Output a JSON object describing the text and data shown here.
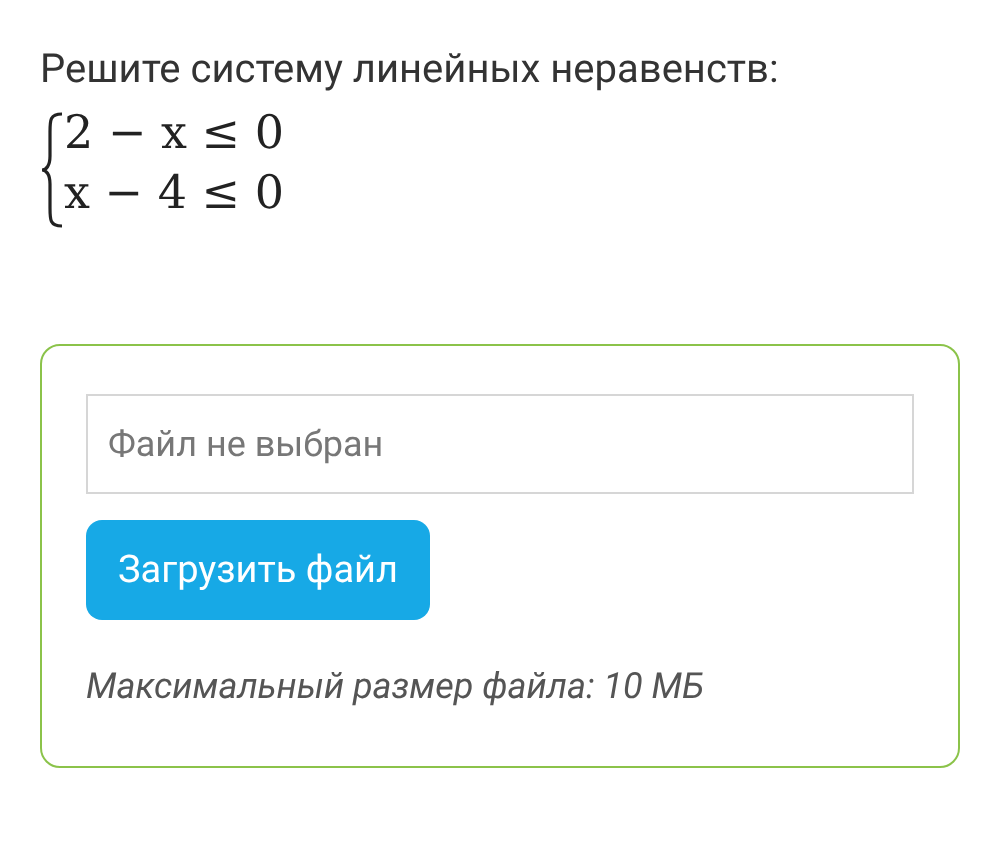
{
  "task": {
    "title": "Решите систему линейных неравенств:",
    "system": [
      "2 − x ≤ 0",
      "x − 4 ≤ 0"
    ]
  },
  "upload": {
    "file_field": {
      "placeholder": "Файл не выбран"
    },
    "button": "Загрузить файл",
    "hint": "Максимальный размер файла: 10 МБ"
  }
}
